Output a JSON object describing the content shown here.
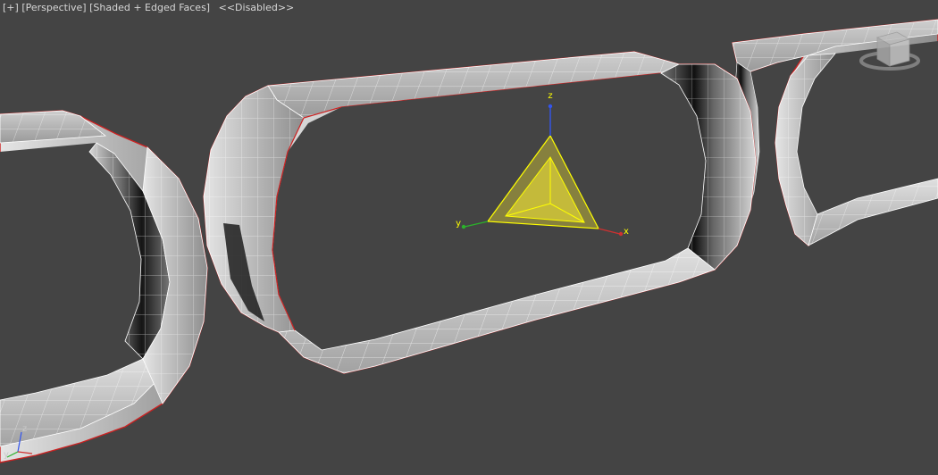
{
  "viewport": {
    "menu_plus": "[+]",
    "menu_view": "[Perspective]",
    "menu_shading": "[Shaded + Edged Faces]",
    "menu_status": "<<Disabled>>"
  },
  "gizmo": {
    "axis_x": "x",
    "axis_y": "y",
    "axis_z": "z"
  },
  "world_axis": {
    "axis_y": "y",
    "axis_z": "z"
  },
  "colors": {
    "background": "#444444",
    "mesh_face": "#b9b9b9",
    "mesh_edge": "#ffffff",
    "selection_outline": "#cc2222",
    "light_helper": "#ffff00",
    "axis_x": "#d03030",
    "axis_y": "#2bb22b",
    "axis_z": "#3355ee"
  },
  "viewcube": {
    "icon": "viewcube-icon"
  }
}
